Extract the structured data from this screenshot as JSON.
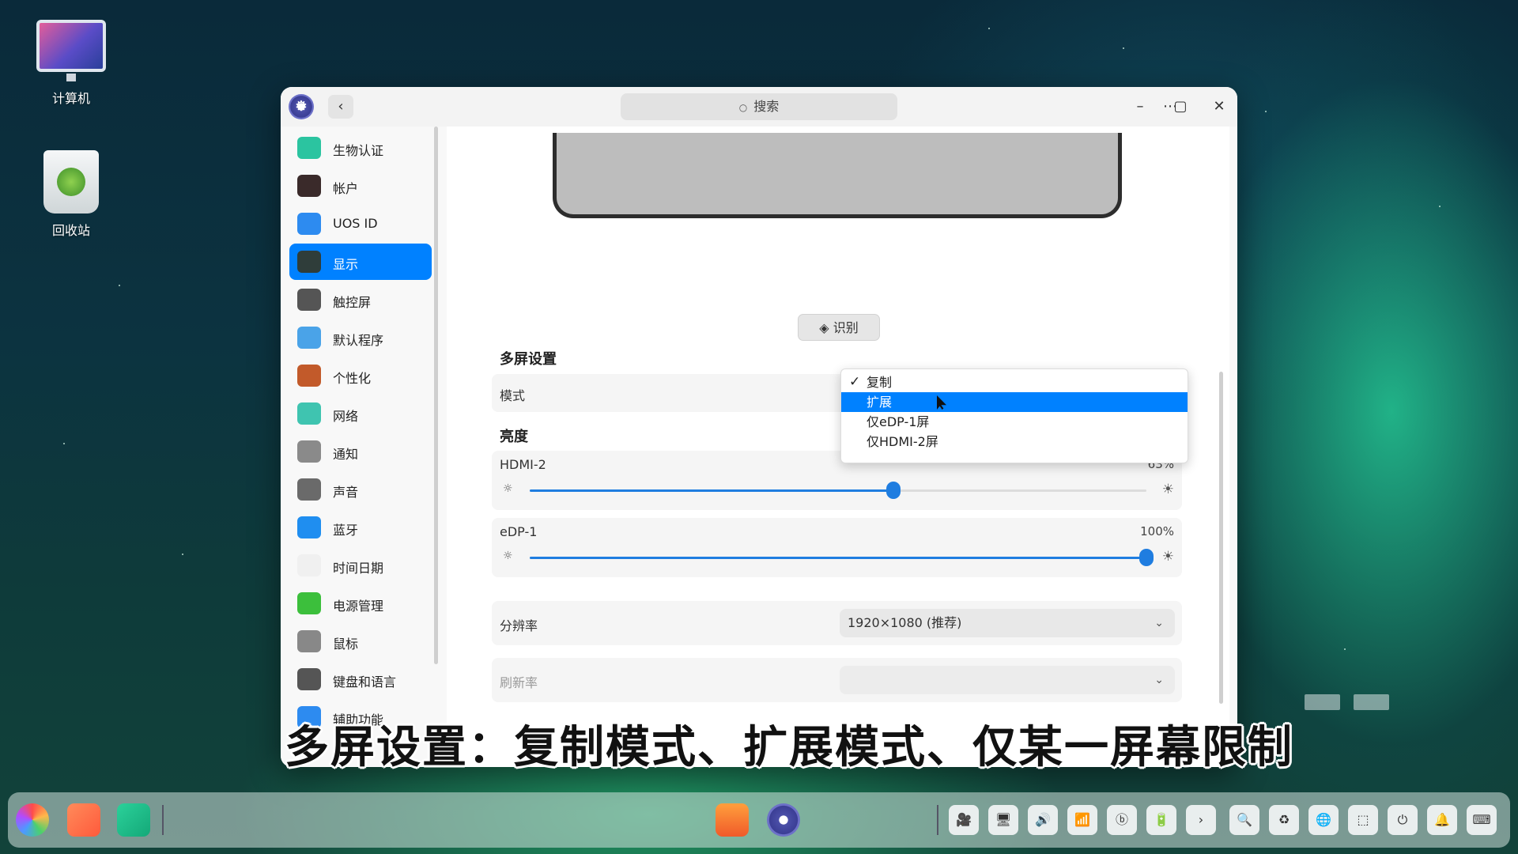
{
  "desktop": {
    "icons": [
      {
        "label": "计算机"
      },
      {
        "label": "回收站"
      }
    ]
  },
  "window": {
    "search_placeholder": "搜索",
    "back_glyph": "‹",
    "menu_glyph": "⋯",
    "minimize_glyph": "–",
    "maximize_glyph": "▢",
    "close_glyph": "✕"
  },
  "sidebar": {
    "items": [
      {
        "label": "生物认证",
        "icon": "fingerprint-icon",
        "color": "#2bc4a0"
      },
      {
        "label": "帐户",
        "icon": "account-icon",
        "color": "#3a2a2a"
      },
      {
        "label": "UOS ID",
        "icon": "cloud-icon",
        "color": "#2d8bf0"
      },
      {
        "label": "显示",
        "icon": "display-icon",
        "color": "#2f3d3a"
      },
      {
        "label": "触控屏",
        "icon": "touchscreen-icon",
        "color": "#555555"
      },
      {
        "label": "默认程序",
        "icon": "default-apps-icon",
        "color": "#4aa3e8"
      },
      {
        "label": "个性化",
        "icon": "personalization-icon",
        "color": "#c25a2a"
      },
      {
        "label": "网络",
        "icon": "network-icon",
        "color": "#3fc4b0"
      },
      {
        "label": "通知",
        "icon": "bell-icon",
        "color": "#8a8a8a"
      },
      {
        "label": "声音",
        "icon": "speaker-icon",
        "color": "#6a6a6a"
      },
      {
        "label": "蓝牙",
        "icon": "bluetooth-icon",
        "color": "#1f8ef0"
      },
      {
        "label": "时间日期",
        "icon": "clock-icon",
        "color": "#f0f0f0"
      },
      {
        "label": "电源管理",
        "icon": "battery-icon",
        "color": "#3cbf3c"
      },
      {
        "label": "鼠标",
        "icon": "mouse-icon",
        "color": "#888888"
      },
      {
        "label": "键盘和语言",
        "icon": "keyboard-icon",
        "color": "#555555"
      },
      {
        "label": "辅助功能",
        "icon": "accessibility-icon",
        "color": "#2d8bf0"
      }
    ],
    "active_index": 3
  },
  "display": {
    "identify_label": "识别",
    "multi_screen_title": "多屏设置",
    "mode_label": "模式",
    "brightness_title": "亮度",
    "brightness": [
      {
        "name": "HDMI-2",
        "percent_label": "63%",
        "value": 0.59
      },
      {
        "name": "eDP-1",
        "percent_label": "100%",
        "value": 1.0
      }
    ],
    "resolution_label": "分辨率",
    "resolution_value": "1920×1080 (推荐)",
    "refresh_label": "刷新率",
    "refresh_value": ""
  },
  "mode_dropdown": {
    "options": [
      {
        "label": "复制",
        "checked": true,
        "highlighted": false
      },
      {
        "label": "扩展",
        "checked": false,
        "highlighted": true
      },
      {
        "label": "仅eDP-1屏",
        "checked": false,
        "highlighted": false
      },
      {
        "label": "仅HDMI-2屏",
        "checked": false,
        "highlighted": false
      }
    ]
  },
  "caption": "多屏设置：复制模式、扩展模式、仅某一屏幕限制",
  "taskbar": {
    "tray_glyphs": [
      "🎥",
      "🖥",
      "🔊",
      "📶",
      "ⓑ",
      "🔋",
      "›",
      "🔍",
      "♻",
      "🌐",
      "⬚",
      "⏻",
      "🔔",
      "⌨"
    ]
  },
  "colors": {
    "accent": "#0081ff",
    "slider": "#1f7de0"
  }
}
